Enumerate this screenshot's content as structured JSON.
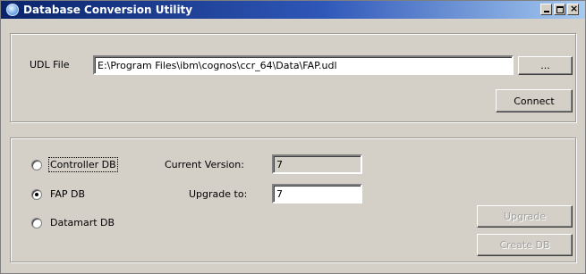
{
  "window": {
    "title": "Database Conversion Utility",
    "controls": {
      "minimize_icon": "minimize-icon",
      "maximize_icon": "maximize-icon",
      "close_icon": "close-icon"
    }
  },
  "connection": {
    "udl_label": "UDL File",
    "udl_path": "E:\\Program Files\\ibm\\cognos\\ccr_64\\Data\\FAP.udl",
    "browse_label": "...",
    "connect_label": "Connect"
  },
  "database": {
    "options": [
      {
        "label": "Controller DB",
        "selected": false
      },
      {
        "label": "FAP DB",
        "selected": true
      },
      {
        "label": "Datamart DB",
        "selected": false
      }
    ],
    "current_version_label": "Current Version:",
    "current_version_value": "7",
    "upgrade_to_label": "Upgrade to:",
    "upgrade_to_value": "7",
    "upgrade_label": "Upgrade",
    "create_db_label": "Create DB"
  }
}
